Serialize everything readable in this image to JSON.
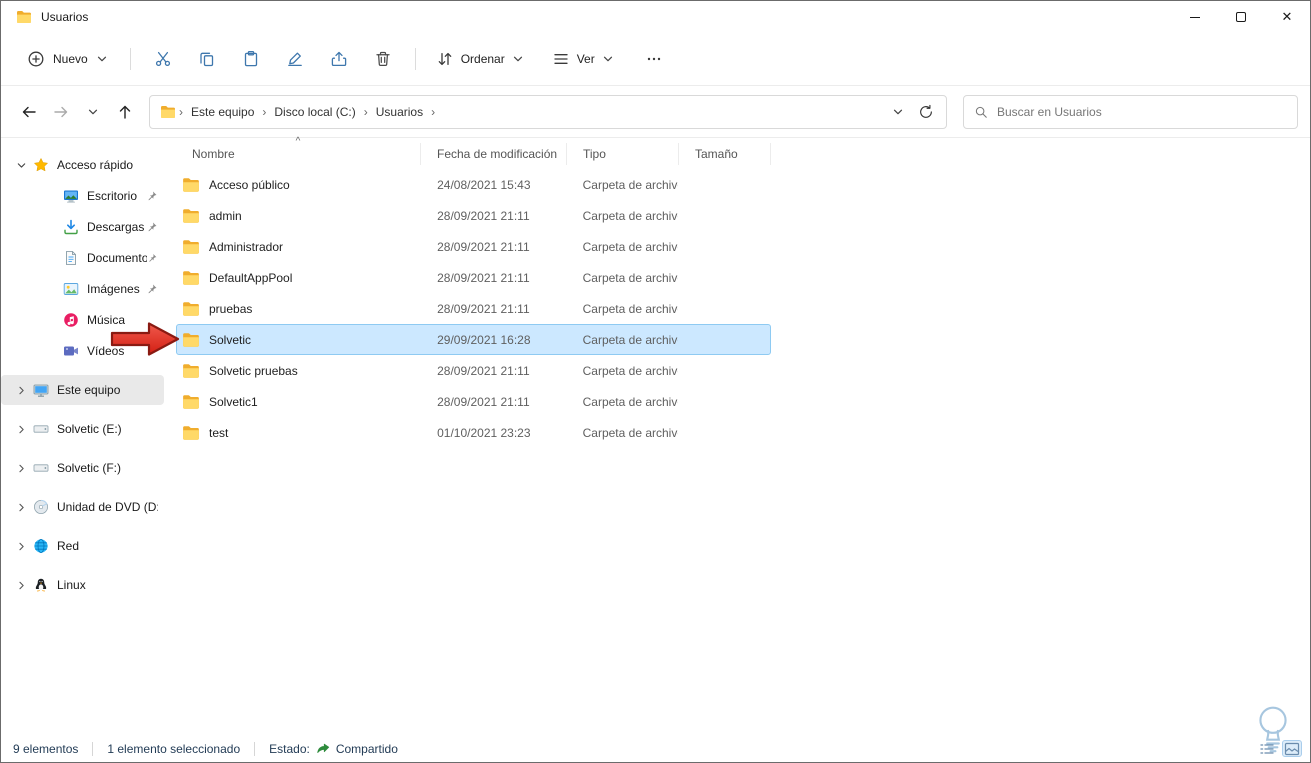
{
  "window": {
    "tab_title": "Usuarios"
  },
  "toolbar": {
    "new_label": "Nuevo",
    "sort_label": "Ordenar",
    "view_label": "Ver"
  },
  "address_bar": {
    "breadcrumbs": [
      {
        "label": "Este equipo"
      },
      {
        "label": "Disco local (C:)"
      },
      {
        "label": "Usuarios"
      }
    ],
    "search_placeholder": "Buscar en Usuarios"
  },
  "sidebar": {
    "sections": [
      {
        "label": "Acceso rápido",
        "icon": "star-icon",
        "expanded": true,
        "selected": false,
        "children": [
          {
            "label": "Escritorio",
            "icon": "monitor-icon",
            "pinned": true
          },
          {
            "label": "Descargas",
            "icon": "download-icon",
            "pinned": true
          },
          {
            "label": "Documentos",
            "icon": "document-icon",
            "pinned": true
          },
          {
            "label": "Imágenes",
            "icon": "picture-icon",
            "pinned": true
          },
          {
            "label": "Música",
            "icon": "music-icon",
            "pinned": false
          },
          {
            "label": "Vídeos",
            "icon": "video-icon",
            "pinned": false
          }
        ]
      },
      {
        "label": "Este equipo",
        "icon": "pc-icon",
        "expanded": false,
        "selected": true,
        "children": []
      },
      {
        "label": "Solvetic (E:)",
        "icon": "drive-icon",
        "expanded": false,
        "selected": false,
        "children": []
      },
      {
        "label": "Solvetic (F:)",
        "icon": "drive-icon",
        "expanded": false,
        "selected": false,
        "children": []
      },
      {
        "label": "Unidad de DVD (D:)",
        "icon": "dvd-icon",
        "expanded": false,
        "selected": false,
        "children": []
      },
      {
        "label": "Red",
        "icon": "network-icon",
        "expanded": false,
        "selected": false,
        "children": []
      },
      {
        "label": "Linux",
        "icon": "linux-icon",
        "expanded": false,
        "selected": false,
        "children": []
      }
    ]
  },
  "file_list": {
    "columns": [
      {
        "label": "Nombre",
        "sort": "asc"
      },
      {
        "label": "Fecha de modificación"
      },
      {
        "label": "Tipo"
      },
      {
        "label": "Tamaño"
      }
    ],
    "rows": [
      {
        "name": "Acceso público",
        "modified": "24/08/2021 15:43",
        "type": "Carpeta de archivos",
        "size": "",
        "icon": "folder-icon",
        "selected": false
      },
      {
        "name": "admin",
        "modified": "28/09/2021 21:11",
        "type": "Carpeta de archivos",
        "size": "",
        "icon": "folder-icon",
        "selected": false
      },
      {
        "name": "Administrador",
        "modified": "28/09/2021 21:11",
        "type": "Carpeta de archivos",
        "size": "",
        "icon": "folder-icon",
        "selected": false
      },
      {
        "name": "DefaultAppPool",
        "modified": "28/09/2021 21:11",
        "type": "Carpeta de archivos",
        "size": "",
        "icon": "folder-icon",
        "selected": false
      },
      {
        "name": "pruebas",
        "modified": "28/09/2021 21:11",
        "type": "Carpeta de archivos",
        "size": "",
        "icon": "folder-icon",
        "selected": false
      },
      {
        "name": "Solvetic",
        "modified": "29/09/2021 16:28",
        "type": "Carpeta de archivos",
        "size": "",
        "icon": "folder-icon",
        "selected": true
      },
      {
        "name": "Solvetic pruebas",
        "modified": "28/09/2021 21:11",
        "type": "Carpeta de archivos",
        "size": "",
        "icon": "folder-icon",
        "selected": false
      },
      {
        "name": "Solvetic1",
        "modified": "28/09/2021 21:11",
        "type": "Carpeta de archivos",
        "size": "",
        "icon": "folder-icon",
        "selected": false
      },
      {
        "name": "test",
        "modified": "01/10/2021 23:23",
        "type": "Carpeta de archivos",
        "size": "",
        "icon": "folder-icon",
        "selected": false
      }
    ]
  },
  "status_bar": {
    "items_count": "9 elementos",
    "selection_count": "1 elemento seleccionado",
    "state_label": "Estado:",
    "state_value": "Compartido"
  },
  "colors": {
    "row_selection_bg": "#cce8ff",
    "row_selection_border": "#8ecaf2",
    "sidebar_selection_bg": "#e9e9e9",
    "annotation_arrow_red": "#e63329",
    "shared_icon_green": "#2e8b3d",
    "folder_yellow": "#ffd968"
  }
}
